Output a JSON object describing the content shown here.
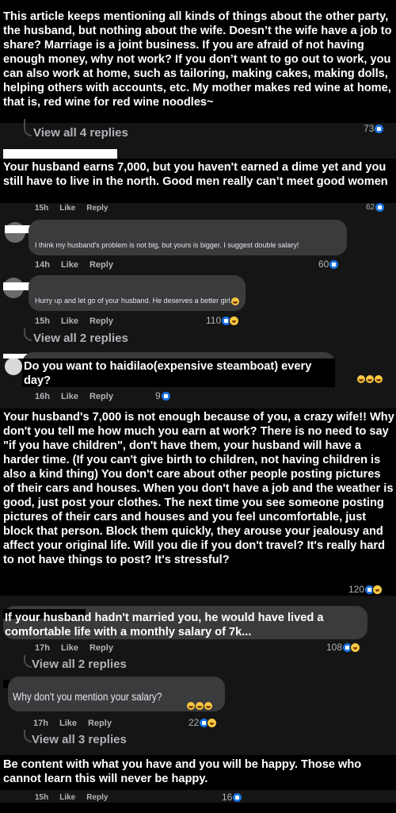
{
  "comments": [
    {
      "text": "This article keeps mentioning all kinds of things about the other party, the husband, but nothing about the wife. Doesn’t the wife have a job to share? Marriage is a joint business. If you are afraid of not having enough money, why not work? If you don’t want to go out to work, you can also work at home, such as tailoring, making cakes, making dolls, helping others with accounts, etc. My mother makes red wine at home, that is, red wine for red wine noodles~",
      "reactions": "73",
      "view_replies": "View all 4 replies"
    },
    {
      "text": "Your husband earns 7,000, but you haven't earned a dime yet and you still have to live in the north. Good men really can’t meet good women",
      "time": "15h",
      "like": "Like",
      "reply": "Reply",
      "reactions": "62"
    },
    {
      "text": "I think my husband's problem is not big, but yours is bigger. I suggest double salary!",
      "time": "14h",
      "like": "Like",
      "reply": "Reply",
      "reactions": "60"
    },
    {
      "text": "Hurry up and let go of your husband. He deserves a better girl.",
      "time": "15h",
      "like": "Like",
      "reply": "Reply",
      "reactions": "110",
      "view_replies": "View all 2 replies"
    },
    {
      "text": "Do you want to haidilao(expensive steamboat) every day?",
      "time": "16h",
      "like": "Like",
      "reply": "Reply",
      "reactions": "9"
    },
    {
      "text": "Your husband's 7,000 is not enough because of you, a crazy wife!! Why don't you tell me how much you earn at work? There is no need to say \"if you have children\", don't have them, your husband will have a harder time. (If you can't give birth to children, not having children is also a kind thing) You don't care about other people posting pictures of their cars and houses. When you don't have a job and the weather is good, just post your clothes. The next time you see someone posting pictures of their cars and houses and you feel uncomfortable, just block that person. Block them quickly, they arouse your jealousy and affect your original life. Will you die if you don't travel? It's really hard to not have things to post? It's stressful?",
      "reactions": "120"
    },
    {
      "text": "If your husband hadn't married you, he would have lived a comfortable life with a monthly salary of 7k...",
      "time": "17h",
      "like": "Like",
      "reply": "Reply",
      "reactions": "108",
      "view_replies": "View all 2 replies"
    },
    {
      "text": "Why don't you mention your salary?",
      "time": "17h",
      "like": "Like",
      "reply": "Reply",
      "reactions": "22",
      "view_replies": "View all 3 replies"
    },
    {
      "text": "Be content with what you have and you will be happy. Those who cannot learn this will never be happy.",
      "time": "15h",
      "like": "Like",
      "reply": "Reply",
      "reactions": "16"
    }
  ]
}
